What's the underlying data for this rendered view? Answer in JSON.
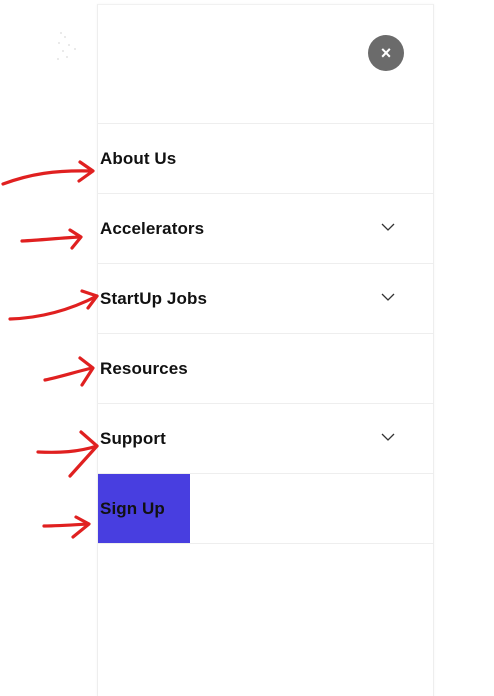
{
  "menu": {
    "items": [
      {
        "label": "About Us",
        "has_submenu": false
      },
      {
        "label": "Accelerators",
        "has_submenu": true
      },
      {
        "label": "StartUp Jobs",
        "has_submenu": true
      },
      {
        "label": "Resources",
        "has_submenu": false
      },
      {
        "label": "Support",
        "has_submenu": true
      }
    ],
    "signup_label": "Sign Up",
    "close_label": "×"
  },
  "colors": {
    "signup_bg": "#483ee0",
    "close_bg": "#6b6b6b",
    "annotation_arrow": "#e02020",
    "divider": "#eeeeee"
  },
  "icons": {
    "close": "close-icon",
    "submenu": "chevron-down-icon",
    "annotation": "hand-drawn-arrow-icon"
  }
}
